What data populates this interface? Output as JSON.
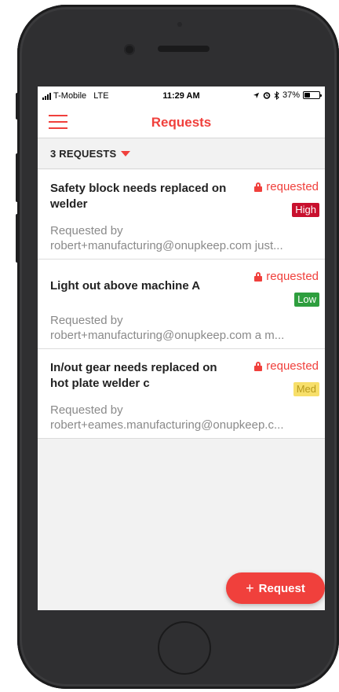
{
  "status_bar": {
    "carrier": "T-Mobile",
    "network": "LTE",
    "time": "11:29 AM",
    "icons": [
      "location-icon",
      "alarm-icon",
      "bluetooth-icon"
    ],
    "battery": "37%",
    "battery_level": 0.37
  },
  "nav": {
    "title": "Requests",
    "menu_icon": "hamburger-menu-icon"
  },
  "list_header": {
    "count_label": "3 REQUESTS"
  },
  "requests": [
    {
      "title": "Safety block needs replaced on welder",
      "status": "requested",
      "priority": "High",
      "requested_by_label": "Requested by",
      "requested_by": "robert+manufacturing@onupkeep.com just..."
    },
    {
      "title": "Light out above machine A",
      "status": "requested",
      "priority": "Low",
      "requested_by_label": "Requested by",
      "requested_by": "robert+manufacturing@onupkeep.com a m..."
    },
    {
      "title": "In/out gear needs replaced on hot plate welder c",
      "status": "requested",
      "priority": "Med",
      "requested_by_label": "Requested by",
      "requested_by": "robert+eames.manufacturing@onupkeep.c..."
    }
  ],
  "fab": {
    "icon": "+",
    "label": "Request"
  },
  "colors": {
    "accent": "#f0403c",
    "high": "#c8102e",
    "low": "#2e9e3e",
    "med": "#f7df6a"
  }
}
